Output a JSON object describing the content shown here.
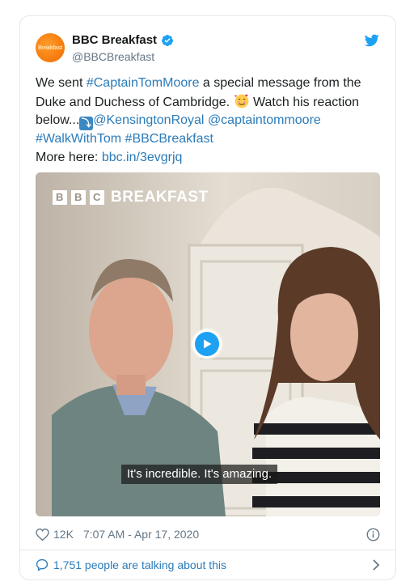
{
  "tweet": {
    "avatar_text": "Breakfast",
    "display_name": "BBC Breakfast",
    "handle": "@BBCBreakfast",
    "text_part1": "We sent ",
    "hashtag_tom": "#CaptainTomMoore",
    "text_part2": " a special message from the Duke and Duchess of Cambridge. ",
    "text_part3": " Watch his reaction below...",
    "mention_royal": "@KensingtonRoyal",
    "mention_tom": "@captaintommoore",
    "hashtag_walk": "#WalkWithTom",
    "hashtag_bbc": "#BBCBreakfast",
    "more_here": "More here: ",
    "short_link": "bbc.in/3evgrjq"
  },
  "video": {
    "watermark_letters": [
      "B",
      "B",
      "C"
    ],
    "watermark_word": "BREAKFAST",
    "subtitle": "It's incredible. It's amazing."
  },
  "meta": {
    "likes": "12K",
    "timestamp": "7:07 AM - Apr 17, 2020"
  },
  "footer": {
    "talking": "1,751 people are talking about this"
  },
  "colors": {
    "link": "#2b7bb9",
    "verified": "#1da1f2",
    "brand_orange": "#f06a00"
  },
  "icons": [
    "verified-badge-icon",
    "twitter-bird-icon",
    "play-icon",
    "heart-icon",
    "info-icon",
    "comment-bubble-icon",
    "chevron-right-icon"
  ]
}
